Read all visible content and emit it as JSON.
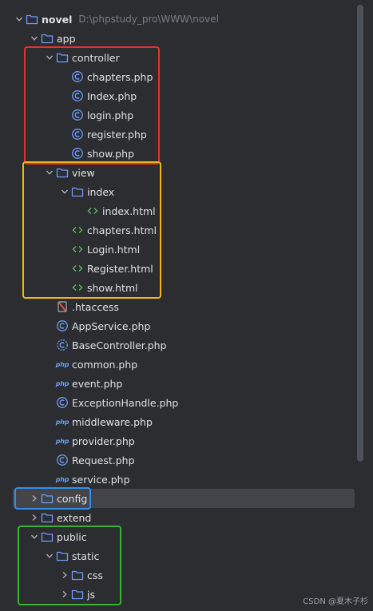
{
  "project": {
    "name": "novel",
    "path": "D:\\phpstudy_pro\\WWW\\novel"
  },
  "rows": [
    {
      "label": "novel",
      "type": "folder",
      "indent": 0,
      "chevron": "down",
      "bold": true
    },
    {
      "label": "app",
      "type": "folder",
      "indent": 1,
      "chevron": "down"
    },
    {
      "label": "controller",
      "type": "folder",
      "indent": 2,
      "chevron": "down"
    },
    {
      "label": "chapters.php",
      "type": "class",
      "indent": 3
    },
    {
      "label": "Index.php",
      "type": "class",
      "indent": 3
    },
    {
      "label": "login.php",
      "type": "class",
      "indent": 3
    },
    {
      "label": "register.php",
      "type": "class",
      "indent": 3
    },
    {
      "label": "show.php",
      "type": "class",
      "indent": 3
    },
    {
      "label": "view",
      "type": "folder",
      "indent": 2,
      "chevron": "down"
    },
    {
      "label": "index",
      "type": "folder",
      "indent": 3,
      "chevron": "down"
    },
    {
      "label": "index.html",
      "type": "html",
      "indent": 4
    },
    {
      "label": "chapters.html",
      "type": "html",
      "indent": 3
    },
    {
      "label": "Login.html",
      "type": "html",
      "indent": 3
    },
    {
      "label": "Register.html",
      "type": "html",
      "indent": 3
    },
    {
      "label": "show.html",
      "type": "html",
      "indent": 3
    },
    {
      "label": ".htaccess",
      "type": "htaccess",
      "indent": 2
    },
    {
      "label": "AppService.php",
      "type": "class",
      "indent": 2
    },
    {
      "label": "BaseController.php",
      "type": "abstract",
      "indent": 2
    },
    {
      "label": "common.php",
      "type": "php",
      "indent": 2
    },
    {
      "label": "event.php",
      "type": "php",
      "indent": 2
    },
    {
      "label": "ExceptionHandle.php",
      "type": "class",
      "indent": 2
    },
    {
      "label": "middleware.php",
      "type": "php",
      "indent": 2
    },
    {
      "label": "provider.php",
      "type": "php",
      "indent": 2
    },
    {
      "label": "Request.php",
      "type": "class",
      "indent": 2
    },
    {
      "label": "service.php",
      "type": "php",
      "indent": 2
    },
    {
      "label": "config",
      "type": "folder",
      "indent": 1,
      "chevron": "right",
      "selected": true
    },
    {
      "label": "extend",
      "type": "folder",
      "indent": 1,
      "chevron": "right"
    },
    {
      "label": "public",
      "type": "folder",
      "indent": 1,
      "chevron": "down"
    },
    {
      "label": "static",
      "type": "folder",
      "indent": 2,
      "chevron": "down"
    },
    {
      "label": "css",
      "type": "folder",
      "indent": 3,
      "chevron": "right"
    },
    {
      "label": "js",
      "type": "folder",
      "indent": 3,
      "chevron": "right"
    }
  ],
  "highlight_boxes": [
    {
      "color": "#e8302b",
      "covers_rows": [
        2,
        7
      ]
    },
    {
      "color": "#f5b316",
      "covers_rows": [
        8,
        14
      ]
    },
    {
      "color": "#2f8ff2",
      "covers_rows": [
        25,
        25
      ]
    },
    {
      "color": "#35b531",
      "covers_rows": [
        27,
        30
      ]
    }
  ],
  "watermark": "CSDN @夏木子杉",
  "colors": {
    "background": "#2b2d30",
    "selected_row": "#43454a",
    "folder_icon": "#6f9bf5",
    "class_icon": "#6f9bf5",
    "html_icon": "#5fb865",
    "path_text": "#7a7e85"
  }
}
